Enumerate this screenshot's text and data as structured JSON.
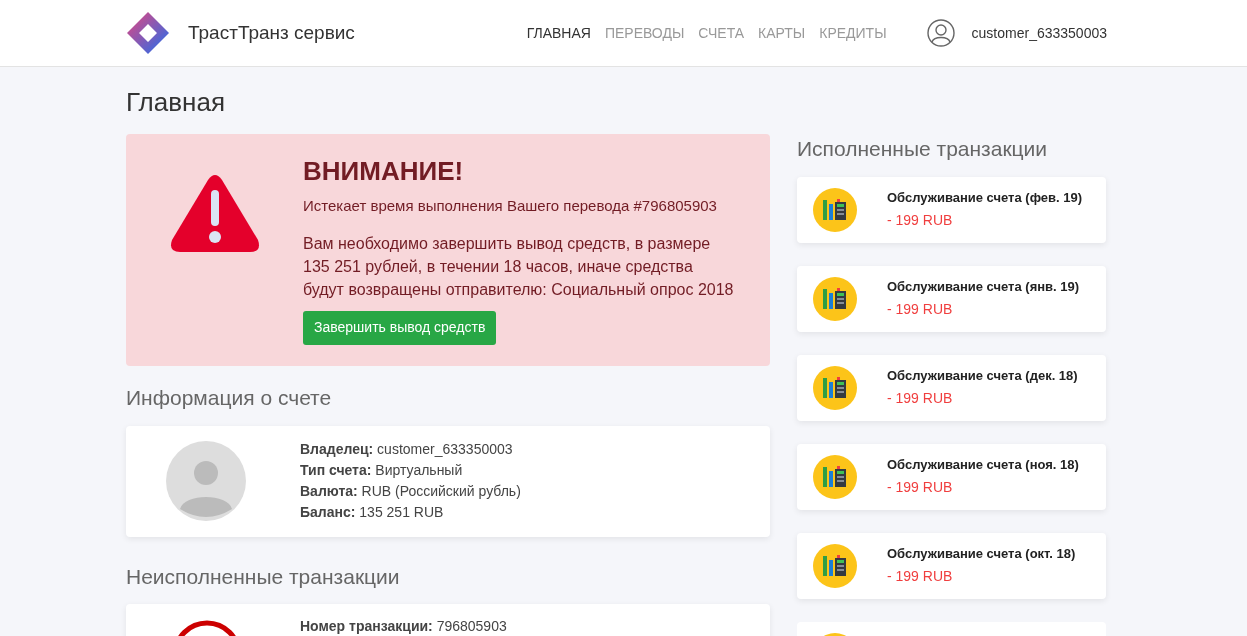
{
  "header": {
    "brand": "ТрастТранз сервис",
    "nav": [
      {
        "label": "ГЛАВНАЯ",
        "selected": true
      },
      {
        "label": "ПЕРЕВОДЫ",
        "selected": false
      },
      {
        "label": "СЧЕТА",
        "selected": false
      },
      {
        "label": "КАРТЫ",
        "selected": false
      },
      {
        "label": "КРЕДИТЫ",
        "selected": false
      }
    ],
    "user": "customer_633350003"
  },
  "page_title": "Главная",
  "alert": {
    "title": "ВНИМАНИЕ!",
    "subtitle": "Истекает время выполнения Вашего перевода #796805903",
    "message": "Вам необходимо завершить вывод средств, в размере 135 251 рублей, в течении 18 часов, иначе средства будут возвращены отправителю: Социальный опрос 2018",
    "button": "Завершить вывод средств"
  },
  "account_info": {
    "title": "Информация о счете",
    "lines": [
      "**Владелец:** customer_633350003",
      "**Тип счета:** Виртуальный",
      "**Валюта:** RUB (Российский рубль)",
      "**Баланс:** 135 251 RUB"
    ]
  },
  "pending": {
    "title": "Неисполненные транзакции",
    "lines": [
      "**Номер транзакции:** 796805903"
    ]
  },
  "completed": {
    "title": "Исполненные транзакции",
    "items": [
      {
        "name": "Обслуживание счета (фев. 19)",
        "amount": "- 199 RUB"
      },
      {
        "name": "Обслуживание счета (янв. 19)",
        "amount": "- 199 RUB"
      },
      {
        "name": "Обслуживание счета (дек. 18)",
        "amount": "- 199 RUB"
      },
      {
        "name": "Обслуживание счета (ноя. 18)",
        "amount": "- 199 RUB"
      },
      {
        "name": "Обслуживание счета (окт. 18)",
        "amount": "- 199 RUB"
      }
    ]
  }
}
